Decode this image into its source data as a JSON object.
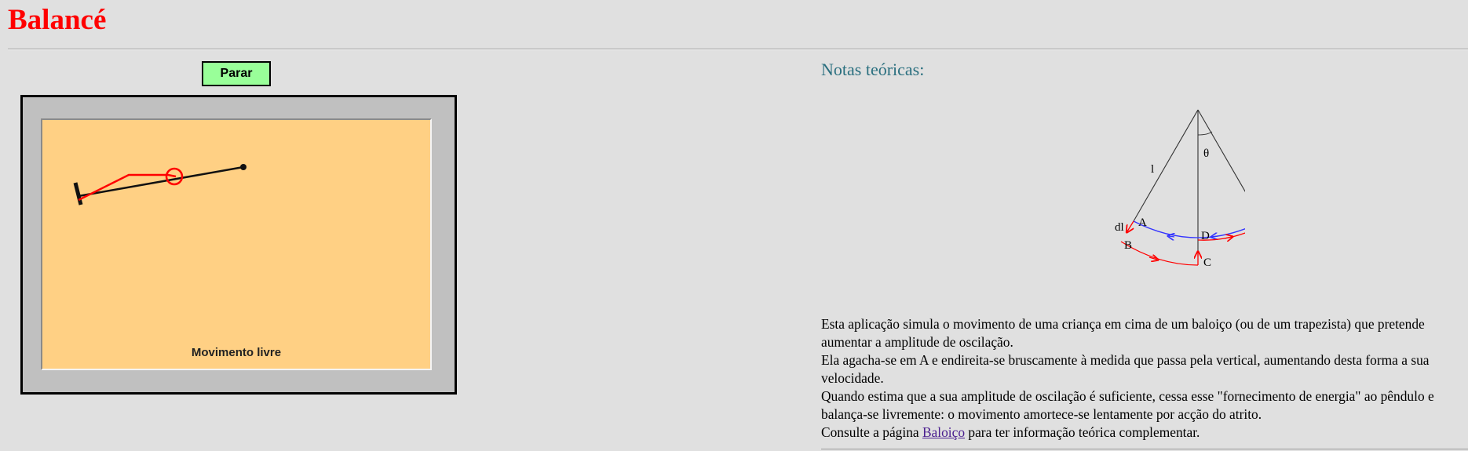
{
  "page": {
    "title": "Balancé"
  },
  "controls": {
    "stop_label": "Parar"
  },
  "simulation": {
    "status": "Movimento livre"
  },
  "notes": {
    "heading": "Notas teóricas:",
    "diagram_labels": {
      "length": "l",
      "angle": "θ",
      "a": "A",
      "b": "B",
      "c": "C",
      "d": "D",
      "dl": "dl"
    },
    "paragraphs": [
      "Esta aplicação simula o movimento de uma criança em cima de um baloiço (ou de um trapezista) que pretende aumentar a amplitude de oscilação.",
      "Ela agacha-se em A e endireita-se bruscamente à medida que passa pela vertical, aumentando desta forma a sua velocidade.",
      "Quando estima que a sua amplitude de oscilação é suficiente, cessa esse \"fornecimento de energia\" ao pêndulo e balança-se livremente: o movimento amortece-se lentamente por acção do atrito."
    ],
    "consult_prefix": "Consulte a página ",
    "consult_link": "Baloiço",
    "consult_suffix": " para ter informação teórica complementar."
  },
  "colors": {
    "title": "#ff0000",
    "button_bg": "#99ff99",
    "canvas_bg": "#ffd084",
    "heading": "#2a6f7f",
    "link": "#4b1f8f",
    "arc_blue": "#3333ff",
    "arc_red": "#ff0000"
  }
}
